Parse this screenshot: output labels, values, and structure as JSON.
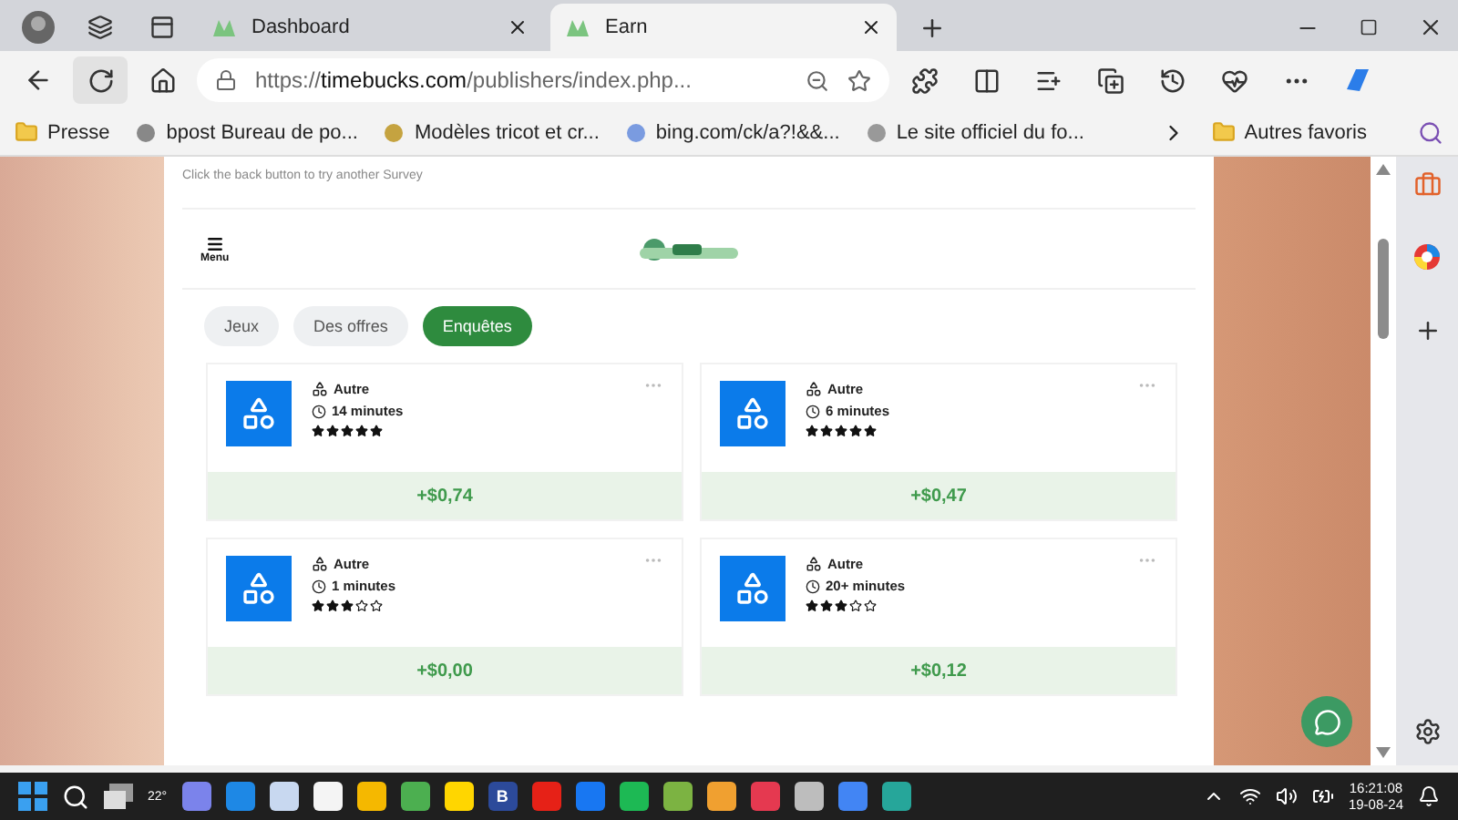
{
  "browser": {
    "tabs": [
      {
        "title": "Dashboard",
        "selected": false
      },
      {
        "title": "Earn",
        "selected": true
      }
    ],
    "url": {
      "scheme": "https://",
      "host": "timebucks.com",
      "path": "/publishers/index.php..."
    },
    "bookmarks": [
      "Presse",
      "bpost Bureau de po...",
      "Modèles tricot et cr...",
      "bing.com/ck/a?!&&...",
      "Le site officiel du fo..."
    ],
    "favorites_label": "Autres favoris"
  },
  "page": {
    "notice": "Click the back button to try another Survey",
    "menu_label": "Menu",
    "filter_tabs": [
      {
        "label": "Jeux",
        "selected": false
      },
      {
        "label": "Des offres",
        "selected": false
      },
      {
        "label": "Enquêtes",
        "selected": true
      }
    ],
    "offers": [
      {
        "category": "Autre",
        "duration": "14 minutes",
        "stars": 5,
        "reward": "+$0,74"
      },
      {
        "category": "Autre",
        "duration": "6 minutes",
        "stars": 5,
        "reward": "+$0,47"
      },
      {
        "category": "Autre",
        "duration": "1 minutes",
        "stars": 3,
        "reward": "+$0,00"
      },
      {
        "category": "Autre",
        "duration": "20+ minutes",
        "stars": 3,
        "reward": "+$0,12"
      }
    ]
  },
  "taskbar": {
    "weather": "22°",
    "app_letter": "B",
    "time": "16:21:08",
    "date": "19-08-24"
  }
}
